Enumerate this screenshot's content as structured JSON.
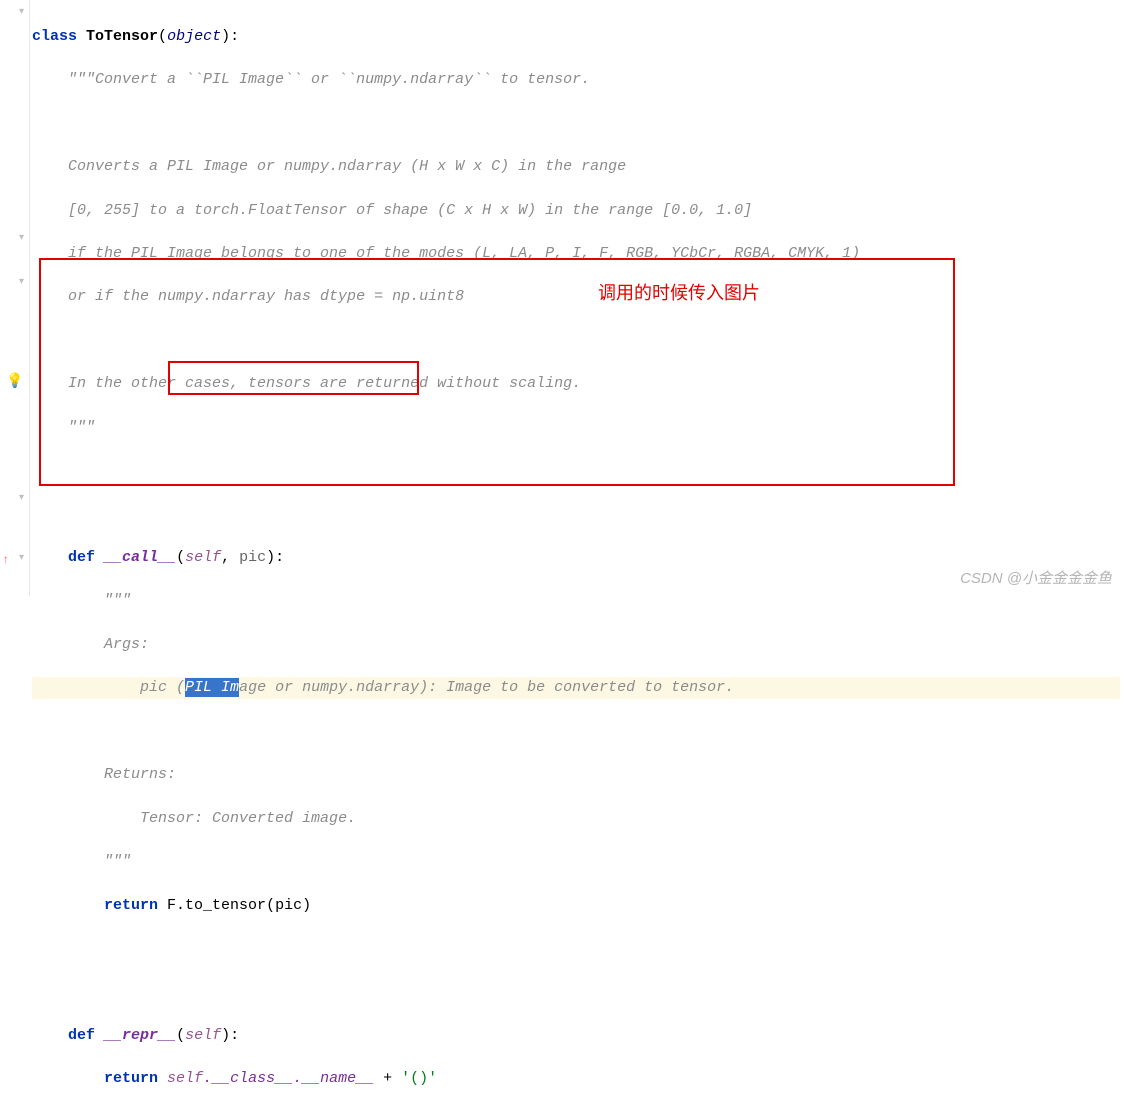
{
  "code": {
    "class_kw": "class",
    "class_name": "ToTensor",
    "object_base": "object",
    "doc_open": "\"\"\"Convert a ``PIL Image`` or ``numpy.ndarray`` to tensor.",
    "doc_l1": "Converts a PIL Image or numpy.ndarray (H x W x C) in the range",
    "doc_l2": "[0, 255] to a torch.FloatTensor of shape (C x H x W) in the range [0.0, 1.0]",
    "doc_l3": "if the PIL Image belongs to one of the modes (L, LA, P, I, F, RGB, YCbCr, RGBA, CMYK, 1)",
    "doc_l4": "or if the numpy.ndarray has dtype = np.uint8",
    "doc_l5": "In the other cases, tensors are returned without scaling.",
    "doc_close": "\"\"\"",
    "def_kw": "def",
    "call_name": "__call__",
    "self_kw": "self",
    "pic_param": "pic",
    "call_doc_open": "\"\"\"",
    "args_label": "Args:",
    "pic_doc_pre": "pic (",
    "pic_doc_sel": "PIL Im",
    "pic_doc_mid": "age or numpy.ndarray",
    "pic_doc_post": "): Image to be converted to tensor.",
    "returns_label": "Returns:",
    "returns_desc": "Tensor: Converted image.",
    "call_doc_close": "\"\"\"",
    "return_kw": "return",
    "call_body": "F.to_tensor(pic)",
    "repr_name": "__repr__",
    "repr_body_a": "self",
    "repr_body_b": ".__class__.__name__",
    "repr_plus": " + ",
    "repr_str": "'()'"
  },
  "annotation": {
    "text": "调用的时候传入图片"
  },
  "watermark": "CSDN @小金金金金鱼"
}
